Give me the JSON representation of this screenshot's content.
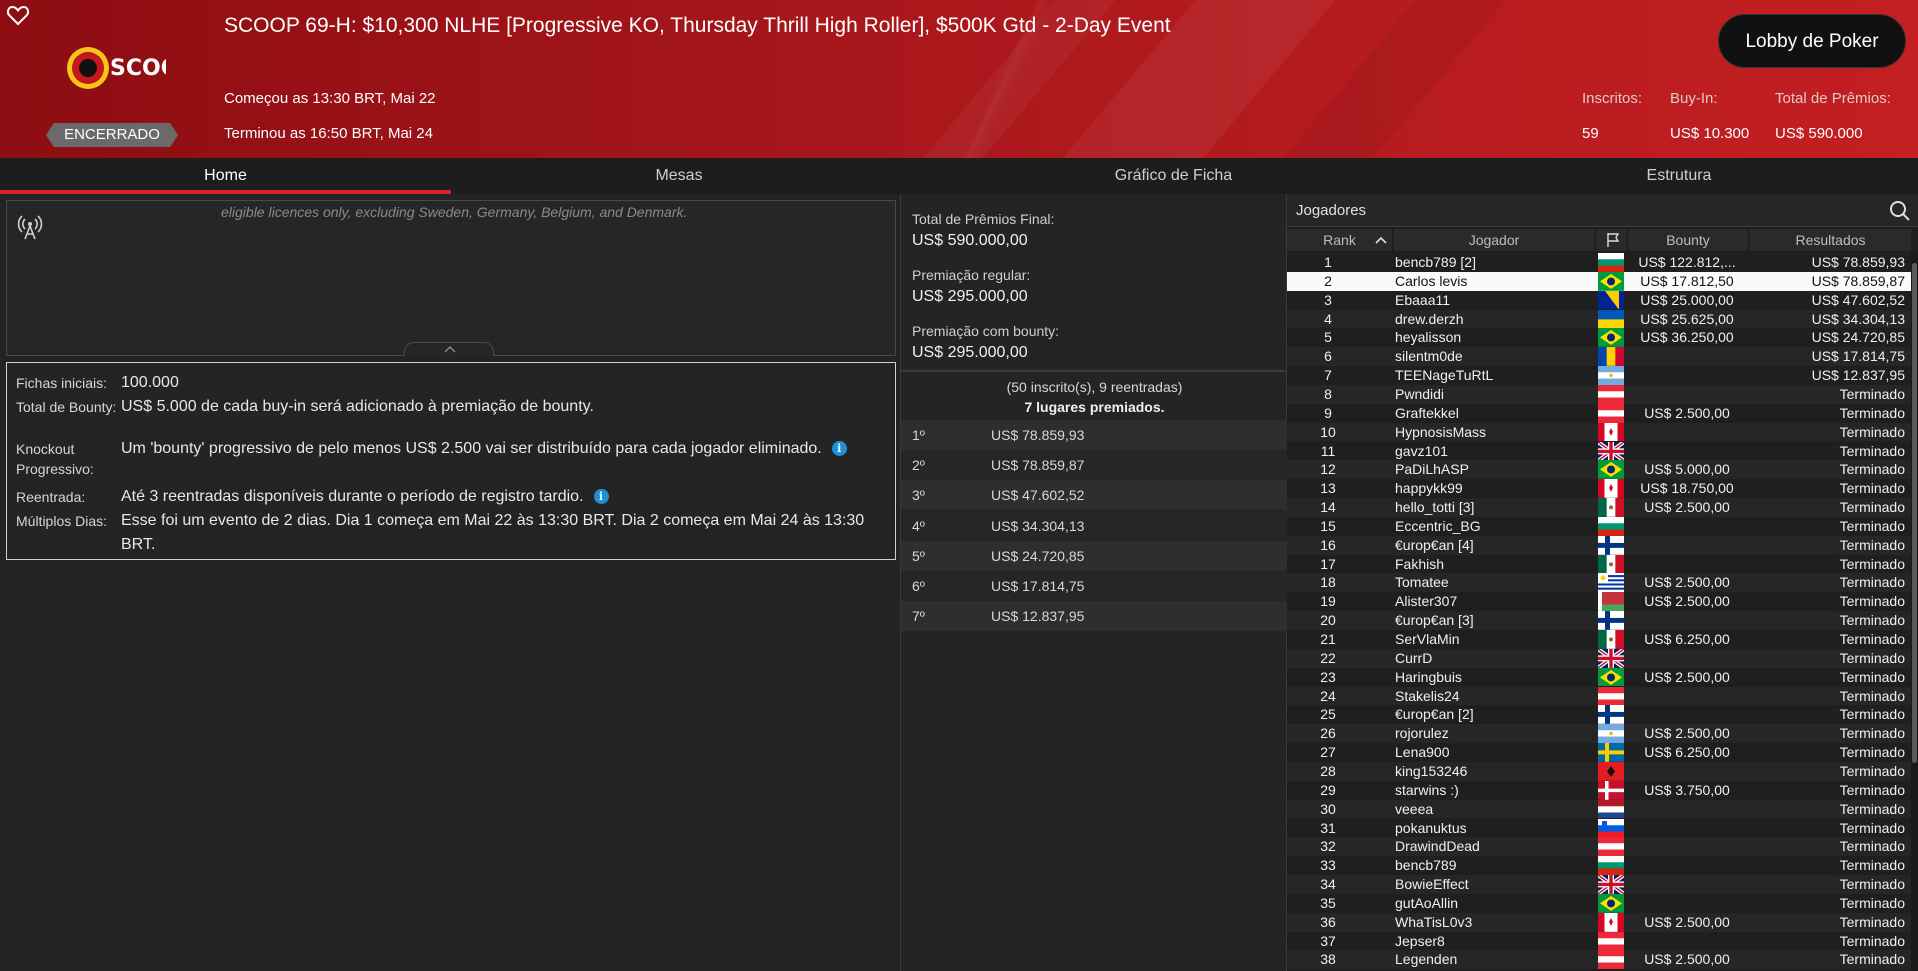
{
  "header": {
    "title": "SCOOP 69-H: $10,300 NLHE [Progressive KO, Thursday Thrill High Roller], $500K Gtd - 2-Day Event",
    "started": "Começou as 13:30 BRT, Mai 22",
    "ended": "Terminou as 16:50 BRT, Mai 24",
    "status": "ENCERRADO",
    "lobby_button": "Lobby de Poker",
    "logo_text": "SCOOP",
    "stats": [
      {
        "label": "Inscritos:",
        "value": "59"
      },
      {
        "label": "Buy-In:",
        "value": "US$ 10.300"
      },
      {
        "label": "Total de Prêmios:",
        "value": "US$ 590.000"
      }
    ]
  },
  "tabs": [
    {
      "label": "Home"
    },
    {
      "label": "Mesas"
    },
    {
      "label": "Gráfico de Ficha"
    },
    {
      "label": "Estrutura"
    }
  ],
  "info_scroll_text": "eligible licences only, excluding Sweden, Germany, Belgium, and Denmark.",
  "details": [
    {
      "label": "Fichas iniciais:",
      "value": "100.000"
    },
    {
      "label": "Total de Bounty:",
      "value": "US$ 5.000 de cada buy-in será adicionado à premiação de bounty."
    },
    {
      "label": "Knockout Progressivo:",
      "value": "Um 'bounty' progressivo de pelo menos US$ 2.500 vai ser distribuído para cada jogador eliminado."
    },
    {
      "label": "Reentrada:",
      "value": "Até 3 reentradas disponíveis durante o período de registro tardio."
    },
    {
      "label": "Múltiplos Dias:",
      "value": "Esse foi um evento de 2 dias. Dia 1 começa em Mai 22 às 13:30 BRT. Dia 2 começa em Mai 24 às 13:30 BRT."
    }
  ],
  "prizes": {
    "final_label": "Total de Prêmios Final:",
    "final_value": "US$ 590.000,00",
    "regular_label": "Premiação regular:",
    "regular_value": "US$ 295.000,00",
    "bounty_label": "Premiação com bounty:",
    "bounty_value": "US$ 295.000,00",
    "entries": "(50 inscrito(s), 9 reentradas)",
    "places": "7 lugares premiados.",
    "payouts": [
      {
        "place": "1º",
        "amount": "US$ 78.859,93"
      },
      {
        "place": "2º",
        "amount": "US$ 78.859,87"
      },
      {
        "place": "3º",
        "amount": "US$ 47.602,52"
      },
      {
        "place": "4º",
        "amount": "US$ 34.304,13"
      },
      {
        "place": "5º",
        "amount": "US$ 24.720,85"
      },
      {
        "place": "6º",
        "amount": "US$ 17.814,75"
      },
      {
        "place": "7º",
        "amount": "US$ 12.837,95"
      }
    ]
  },
  "players": {
    "title": "Jogadores",
    "columns": {
      "rank": "Rank",
      "player": "Jogador",
      "bounty": "Bounty",
      "result": "Resultados"
    },
    "rows": [
      {
        "rank": "1",
        "name": "bencb789 [2]",
        "flag": "bulgaria",
        "bounty": "US$ 122.812,...",
        "result": "US$ 78.859,93"
      },
      {
        "rank": "2",
        "name": "Carlos levis",
        "flag": "brazil",
        "bounty": "US$ 17.812,50",
        "result": "US$ 78.859,87",
        "selected": true
      },
      {
        "rank": "3",
        "name": "Ebaaa11",
        "flag": "bosnia",
        "bounty": "US$ 25.000,00",
        "result": "US$ 47.602,52"
      },
      {
        "rank": "4",
        "name": "drew.derzh",
        "flag": "ukraine",
        "bounty": "US$ 25.625,00",
        "result": "US$ 34.304,13"
      },
      {
        "rank": "5",
        "name": "heyalisson",
        "flag": "brazil",
        "bounty": "US$ 36.250,00",
        "result": "US$ 24.720,85"
      },
      {
        "rank": "6",
        "name": "silentm0de",
        "flag": "moldova",
        "bounty": "",
        "result": "US$ 17.814,75"
      },
      {
        "rank": "7",
        "name": "TEENageTuRtL",
        "flag": "argentina",
        "bounty": "",
        "result": "US$ 12.837,95"
      },
      {
        "rank": "8",
        "name": "Pwndidi",
        "flag": "austria",
        "bounty": "",
        "result": "Terminado"
      },
      {
        "rank": "9",
        "name": "Graftekkel",
        "flag": "austria",
        "bounty": "US$ 2.500,00",
        "result": "Terminado"
      },
      {
        "rank": "10",
        "name": "HypnosisMass",
        "flag": "canada",
        "bounty": "",
        "result": "Terminado"
      },
      {
        "rank": "11",
        "name": "gavz101",
        "flag": "uk",
        "bounty": "",
        "result": "Terminado"
      },
      {
        "rank": "12",
        "name": "PaDiLhASP",
        "flag": "brazil",
        "bounty": "US$ 5.000,00",
        "result": "Terminado"
      },
      {
        "rank": "13",
        "name": "happykk99",
        "flag": "canada",
        "bounty": "US$ 18.750,00",
        "result": "Terminado"
      },
      {
        "rank": "14",
        "name": "hello_totti [3]",
        "flag": "mexico",
        "bounty": "US$ 2.500,00",
        "result": "Terminado"
      },
      {
        "rank": "15",
        "name": "Eccentric_BG",
        "flag": "bulgaria",
        "bounty": "",
        "result": "Terminado"
      },
      {
        "rank": "16",
        "name": "€urop€an [4]",
        "flag": "finland",
        "bounty": "",
        "result": "Terminado"
      },
      {
        "rank": "17",
        "name": "Fakhish",
        "flag": "mexico",
        "bounty": "",
        "result": "Terminado"
      },
      {
        "rank": "18",
        "name": "Tomatee",
        "flag": "uruguay",
        "bounty": "US$ 2.500,00",
        "result": "Terminado"
      },
      {
        "rank": "19",
        "name": "Alister307",
        "flag": "belarus",
        "bounty": "US$ 2.500,00",
        "result": "Terminado"
      },
      {
        "rank": "20",
        "name": "€urop€an [3]",
        "flag": "finland",
        "bounty": "",
        "result": "Terminado"
      },
      {
        "rank": "21",
        "name": "SerVlaMin",
        "flag": "mexico",
        "bounty": "US$ 6.250,00",
        "result": "Terminado"
      },
      {
        "rank": "22",
        "name": "CurrD",
        "flag": "uk",
        "bounty": "",
        "result": "Terminado"
      },
      {
        "rank": "23",
        "name": "Haringbuis",
        "flag": "brazil",
        "bounty": "US$ 2.500,00",
        "result": "Terminado"
      },
      {
        "rank": "24",
        "name": "Stakelis24",
        "flag": "austria",
        "bounty": "",
        "result": "Terminado"
      },
      {
        "rank": "25",
        "name": "€urop€an [2]",
        "flag": "finland",
        "bounty": "",
        "result": "Terminado"
      },
      {
        "rank": "26",
        "name": "rojorulez",
        "flag": "argentina",
        "bounty": "US$ 2.500,00",
        "result": "Terminado"
      },
      {
        "rank": "27",
        "name": "Lena900",
        "flag": "sweden",
        "bounty": "US$ 6.250,00",
        "result": "Terminado"
      },
      {
        "rank": "28",
        "name": "king153246",
        "flag": "albania",
        "bounty": "",
        "result": "Terminado"
      },
      {
        "rank": "29",
        "name": "starwins :)",
        "flag": "denmark",
        "bounty": "US$ 3.750,00",
        "result": "Terminado"
      },
      {
        "rank": "30",
        "name": "veeea",
        "flag": "netherlands",
        "bounty": "",
        "result": "Terminado"
      },
      {
        "rank": "31",
        "name": "pokanuktus",
        "flag": "slovenia",
        "bounty": "",
        "result": "Terminado"
      },
      {
        "rank": "32",
        "name": "DrawindDead",
        "flag": "austria",
        "bounty": "",
        "result": "Terminado"
      },
      {
        "rank": "33",
        "name": "bencb789",
        "flag": "bulgaria",
        "bounty": "",
        "result": "Terminado"
      },
      {
        "rank": "34",
        "name": "BowieEffect",
        "flag": "uk",
        "bounty": "",
        "result": "Terminado"
      },
      {
        "rank": "35",
        "name": "gutAoAllin",
        "flag": "brazil",
        "bounty": "",
        "result": "Terminado"
      },
      {
        "rank": "36",
        "name": "WhaTisL0v3",
        "flag": "canada",
        "bounty": "US$ 2.500,00",
        "result": "Terminado"
      },
      {
        "rank": "37",
        "name": "Jepser8",
        "flag": "austria",
        "bounty": "",
        "result": "Terminado"
      },
      {
        "rank": "38",
        "name": "Legenden",
        "flag": "austria",
        "bounty": "US$ 2.500,00",
        "result": "Terminado"
      }
    ]
  },
  "colors": {
    "accent": "#d8232a",
    "header_red": "#b01a1e",
    "info_blue": "#1e8fd8"
  }
}
